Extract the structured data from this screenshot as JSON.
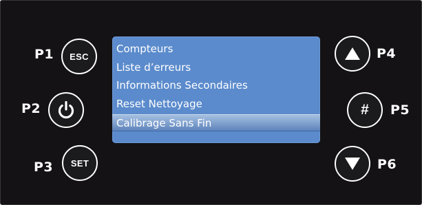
{
  "labels": {
    "p1": "P1",
    "p2": "P2",
    "p3": "P3",
    "p4": "P4",
    "p5": "P5",
    "p6": "P6"
  },
  "buttons": {
    "esc": "ESC",
    "power_icon": "power-icon",
    "set": "SET",
    "up_icon": "up-triangle-icon",
    "hash": "#",
    "down_icon": "down-triangle-icon"
  },
  "menu": {
    "items": [
      {
        "label": "Compteurs"
      },
      {
        "label": "Liste d’erreurs"
      },
      {
        "label": "Informations Secondaires"
      },
      {
        "label": "Reset Nettoyage"
      },
      {
        "label": "Calibrage Sans Fin",
        "selected": true
      }
    ]
  },
  "colors": {
    "panel_bg": "#141214",
    "screen_bg": "#5b8bcc",
    "selection_bg": "#8fabd6",
    "text": "#ffffff"
  }
}
